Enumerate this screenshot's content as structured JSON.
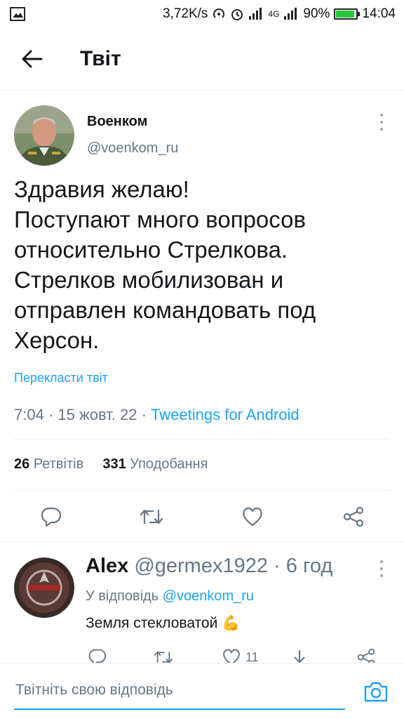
{
  "status_bar": {
    "speed": "3,72K/s",
    "network": "4G",
    "battery": "90%",
    "battery_level": 0.9,
    "time": "14:04"
  },
  "header": {
    "title": "Твіт",
    "back_icon": "arrow-left-icon"
  },
  "tweet": {
    "author_name": "Военком",
    "author_handle": "@voenkom_ru",
    "text_lines": [
      "Здравия желаю!",
      "Поступают много вопросов",
      "относительно Стрелкова.",
      "Стрелков мобилизован и",
      "отправлен командовать под",
      "Херсон."
    ],
    "translate": "Перекласти твіт",
    "time": "7:04",
    "date": "15 жовт. 22",
    "client": "Tweetings for Android",
    "retweets_count": "26",
    "retweets_label": "Ретвітів",
    "likes_count": "331",
    "likes_label": "Уподобання"
  },
  "reply": {
    "name": "Alex",
    "handle": "@germex1922",
    "time": "6 год",
    "reply_to_label": "У відповідь",
    "reply_to_handle": "@voenkom_ru",
    "text": "Земля стекловатой 💪",
    "likes": "11"
  },
  "compose": {
    "placeholder": "Твітніть свою відповідь"
  },
  "colors": {
    "accent": "#1da1f2",
    "secondary_text": "#657786",
    "divider": "#e6ecf0"
  }
}
